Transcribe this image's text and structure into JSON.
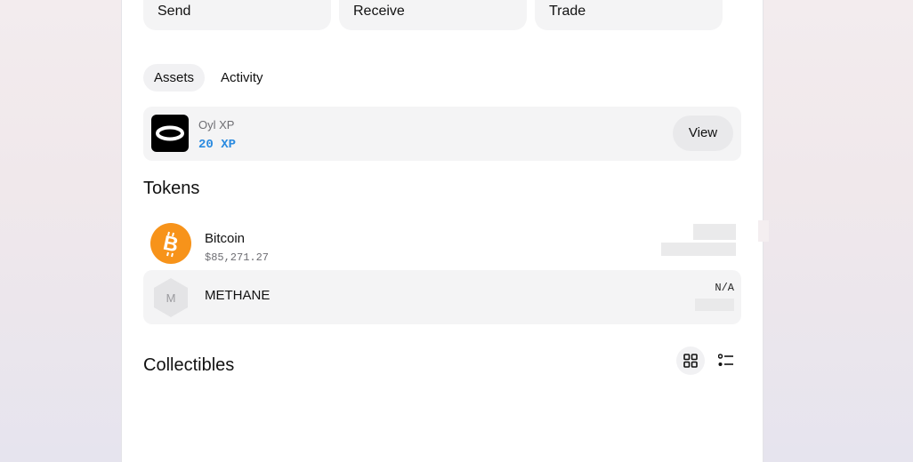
{
  "actions": [
    {
      "label": "Send"
    },
    {
      "label": "Receive"
    },
    {
      "label": "Trade"
    }
  ],
  "tabs": [
    {
      "label": "Assets",
      "active": true
    },
    {
      "label": "Activity",
      "active": false
    }
  ],
  "xp": {
    "title": "Oyl XP",
    "value": "20 XP",
    "view_label": "View"
  },
  "tokens": {
    "title": "Tokens",
    "items": [
      {
        "name": "Bitcoin",
        "price": "$85,271.27",
        "icon": "bitcoin-icon"
      },
      {
        "name": "METHANE",
        "value": "N/A",
        "icon": "methane-icon",
        "icon_letter": "M"
      }
    ]
  },
  "collectibles": {
    "title": "Collectibles",
    "view_mode": "grid"
  },
  "colors": {
    "accent": "#2b8be0",
    "bitcoin": "#f7931a"
  }
}
